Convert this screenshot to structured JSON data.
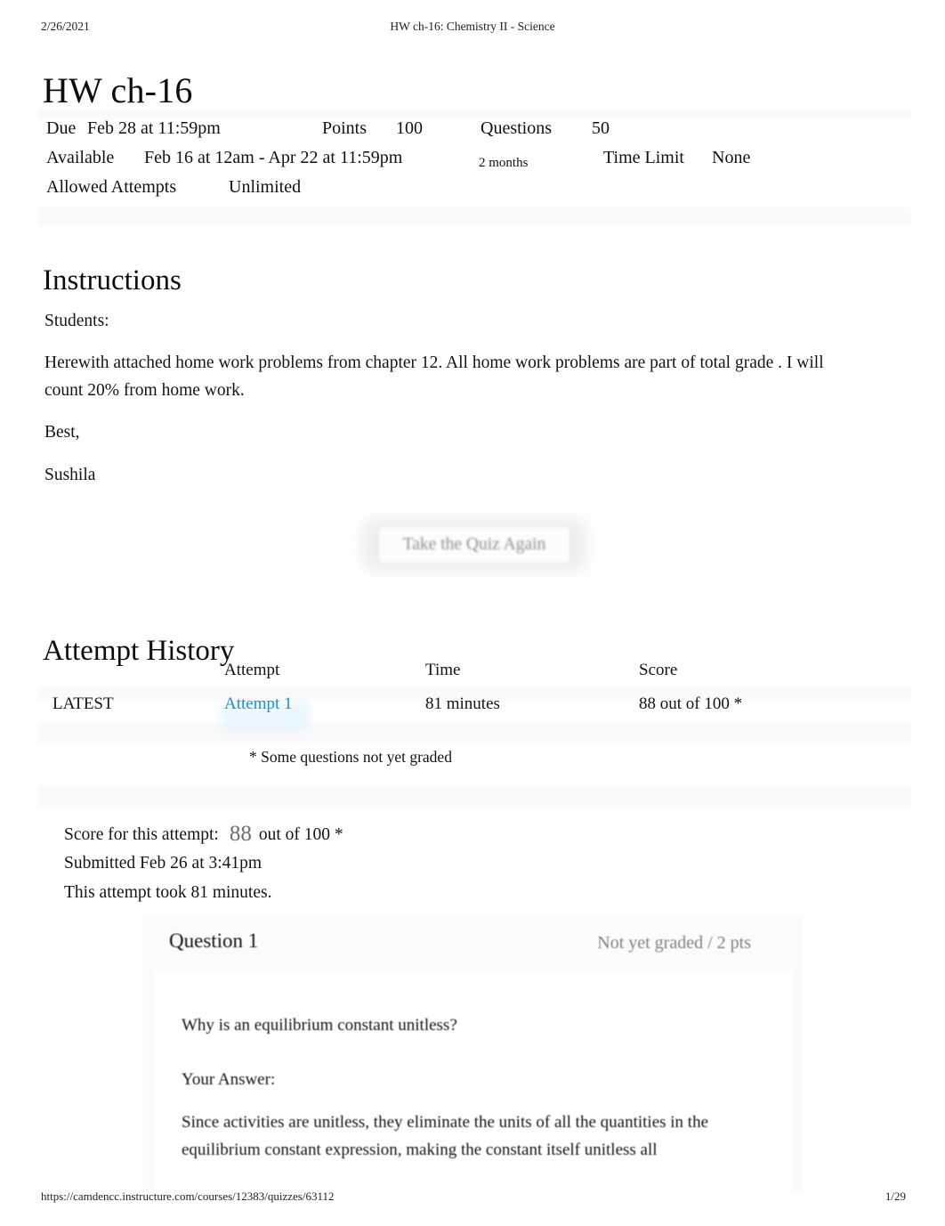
{
  "print_header": {
    "date": "2/26/2021",
    "doc_title": "HW ch-16: Chemistry II - Science"
  },
  "print_footer": {
    "url": "https://camdencc.instructure.com/courses/12383/quizzes/63112",
    "page": "1/29"
  },
  "page_title": "HW ch-16",
  "quiz_meta": {
    "due_label": "Due",
    "due_value": "Feb 28 at 11:59pm",
    "points_label": "Points",
    "points_value": "100",
    "questions_label": "Questions",
    "questions_value": "50",
    "available_label": "Available",
    "available_value": "Feb 16 at 12am - Apr 22 at 11:59pm",
    "available_duration": "2 months",
    "time_limit_label": "Time Limit",
    "time_limit_value": "None",
    "allowed_attempts_label": "Allowed Attempts",
    "allowed_attempts_value": "Unlimited"
  },
  "instructions": {
    "heading": "Instructions",
    "p1": "Students:",
    "p2": "Herewith attached home work problems from chapter 12. All home work problems are part of total grade . I will count 20% from home work.",
    "p3": "Best,",
    "p4": "Sushila"
  },
  "retake_button": {
    "label": "Take the Quiz Again"
  },
  "attempt_history": {
    "heading": "Attempt History",
    "columns": {
      "latest": "",
      "attempt": "Attempt",
      "time": "Time",
      "score": "Score"
    },
    "rows": [
      {
        "latest": "LATEST",
        "attempt": "Attempt 1",
        "time": "81 minutes",
        "score": "88 out of 100 *"
      }
    ],
    "note": "* Some questions not yet graded",
    "link_color": "#1d8fd4"
  },
  "score_summary": {
    "label": "Score for this attempt:",
    "score": "88",
    "out_of": "out of 100 *",
    "submitted": "Submitted Feb 26 at 3:41pm",
    "duration": "This attempt took 81 minutes."
  },
  "question": {
    "title": "Question 1",
    "points_status": "Not yet graded / 2 pts",
    "prompt": "Why is an equilibrium constant unitless?",
    "your_answer_label": "Your Answer:",
    "answer": "Since activities are unitless, they eliminate the units of all the quantities in the equilibrium constant expression, making the constant itself unitless all"
  }
}
